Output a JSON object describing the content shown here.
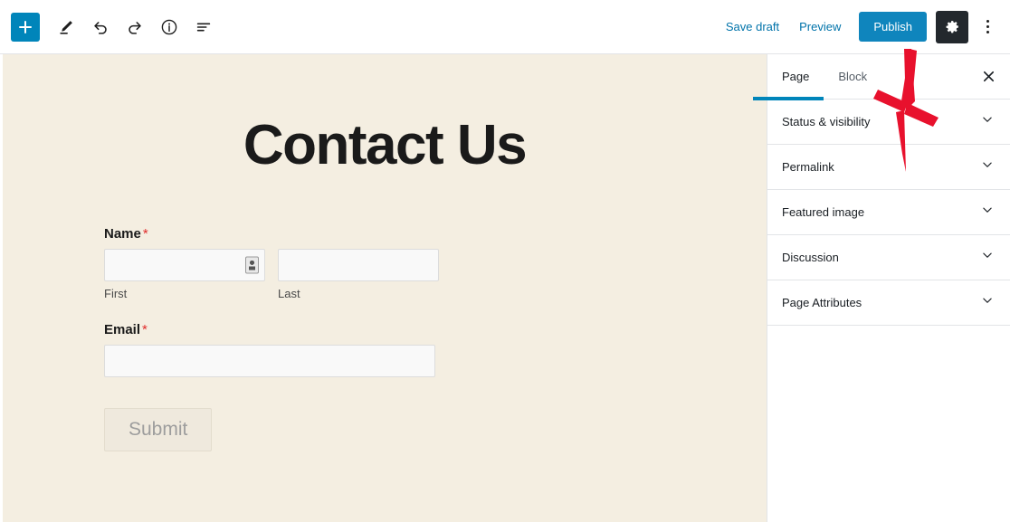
{
  "toolbar": {
    "add_block_label": "+",
    "tools_icon": "pencil-icon",
    "undo_icon": "undo-icon",
    "redo_icon": "redo-icon",
    "info_icon": "info-icon",
    "list_view_icon": "list-view-icon",
    "save_draft_label": "Save draft",
    "preview_label": "Preview",
    "publish_label": "Publish",
    "settings_icon": "gear-icon",
    "more_menu_icon": "kebab-menu-icon",
    "publish_color": "#0f85bd",
    "inserter_color": "#0085ba",
    "settings_button_color": "#23282d"
  },
  "canvas": {
    "background_color": "#f4eee1",
    "page_title": "Contact Us",
    "form": {
      "name": {
        "label": "Name",
        "required_marker": "*",
        "first": {
          "value": "",
          "sub_label": "First",
          "autofill_icon": "contact-card-icon"
        },
        "last": {
          "value": "",
          "sub_label": "Last"
        }
      },
      "email": {
        "label": "Email",
        "required_marker": "*",
        "value": ""
      },
      "submit_label": "Submit"
    }
  },
  "sidebar": {
    "tabs": [
      {
        "label": "Page",
        "active": true
      },
      {
        "label": "Block",
        "active": false
      }
    ],
    "close_icon": "close-icon",
    "active_tab_color": "#0085ba",
    "panels": [
      {
        "label": "Status & visibility",
        "chevron": "chevron-down-icon"
      },
      {
        "label": "Permalink",
        "chevron": "chevron-down-icon"
      },
      {
        "label": "Featured image",
        "chevron": "chevron-down-icon"
      },
      {
        "label": "Discussion",
        "chevron": "chevron-down-icon"
      },
      {
        "label": "Page Attributes",
        "chevron": "chevron-down-icon"
      }
    ]
  },
  "annotation": {
    "arrow_color": "#e8112d",
    "points_to": "publish-button"
  }
}
